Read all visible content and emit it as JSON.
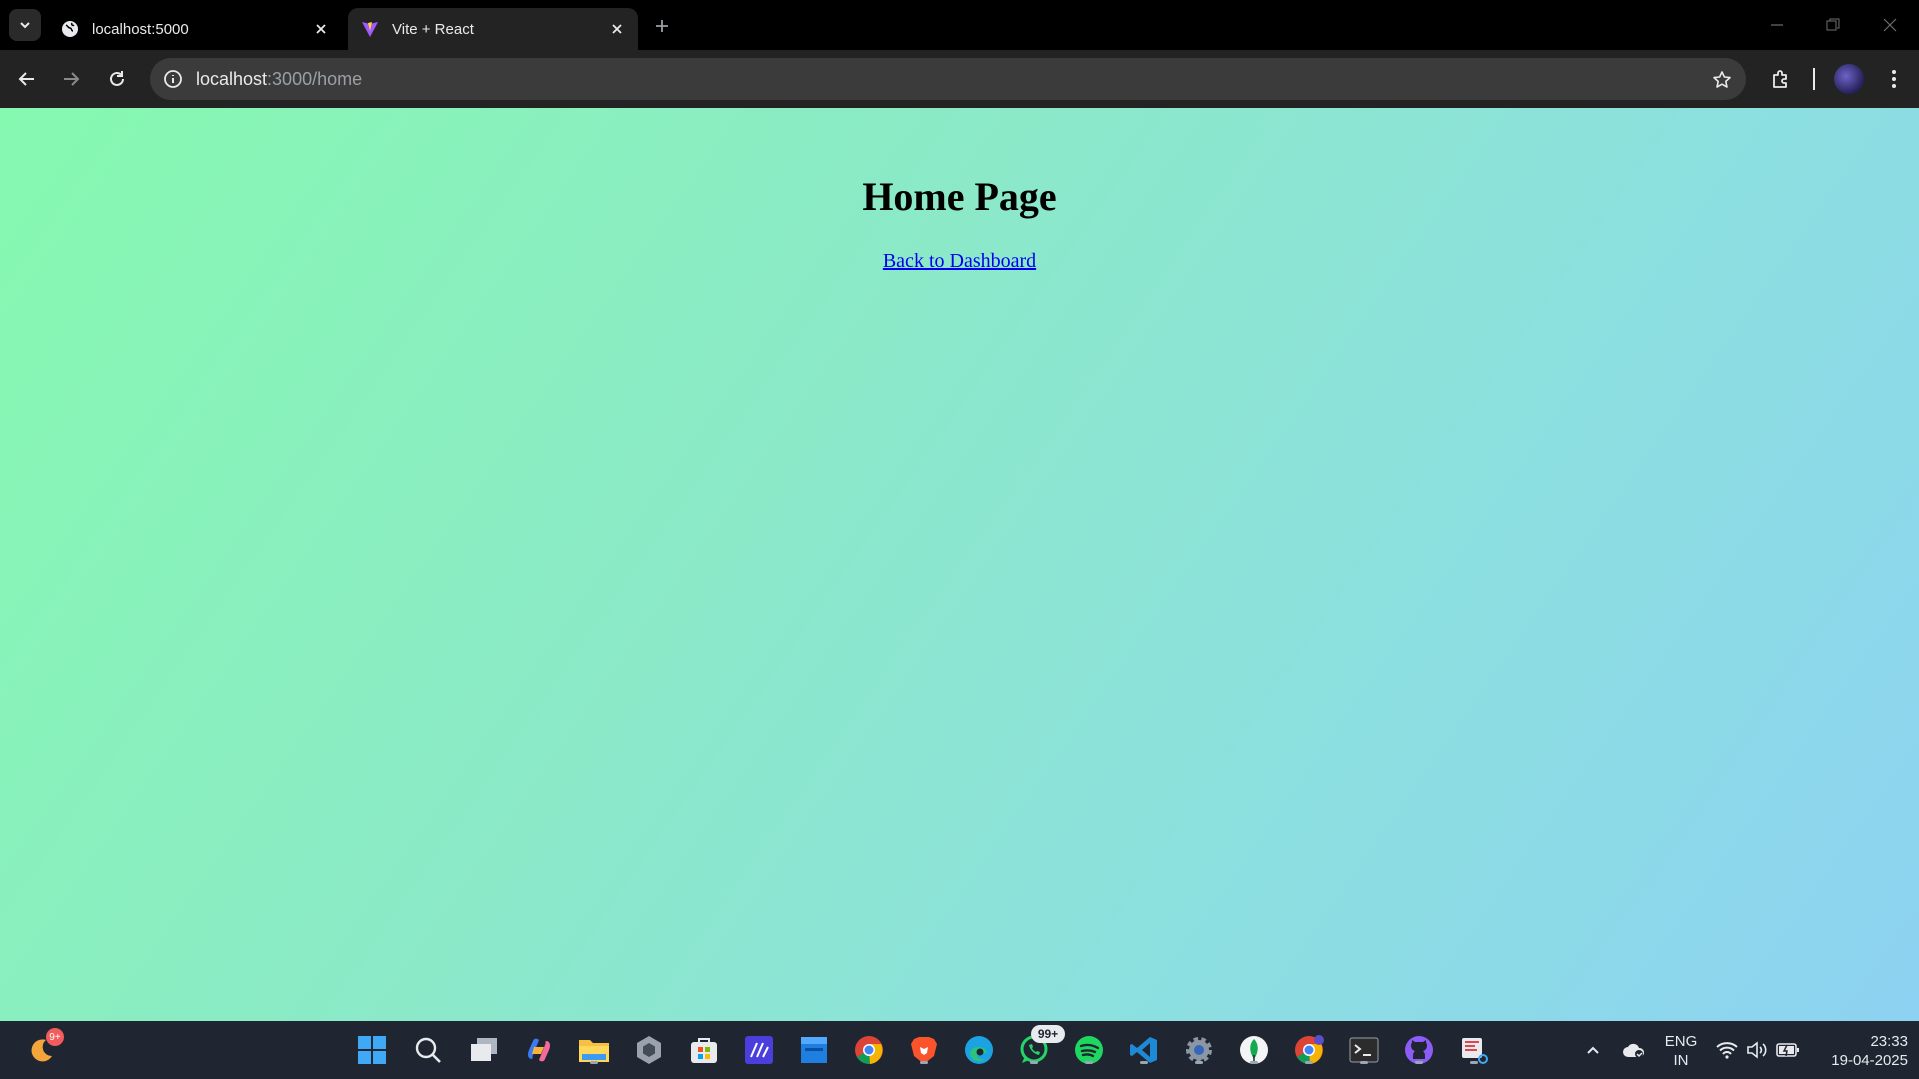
{
  "browser": {
    "tabs": [
      {
        "title": "localhost:5000",
        "active": false
      },
      {
        "title": "Vite + React",
        "active": true
      }
    ],
    "address": {
      "host": "localhost",
      "rest": ":3000/home"
    }
  },
  "page": {
    "heading": "Home Page",
    "link_text": "Back to Dashboard"
  },
  "taskbar": {
    "widget_badge": "9+",
    "whatsapp_badge": "99+",
    "language_line1": "ENG",
    "language_line2": "IN",
    "time": "23:33",
    "date": "19-04-2025"
  },
  "colors": {
    "gradient_start": "#86f9b0",
    "gradient_end": "#8dd2f2",
    "link": "#0000ee",
    "taskbar": "#1f2632"
  }
}
